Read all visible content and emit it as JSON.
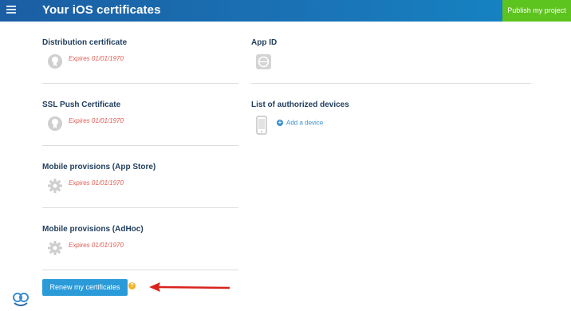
{
  "header": {
    "title": "Your iOS certificates",
    "publish_label": "Publish my project"
  },
  "left_sections": [
    {
      "title": "Distribution certificate",
      "status": "Expires 01/01/1970",
      "icon": "certificate-seal-icon"
    },
    {
      "title": "SSL Push Certificate",
      "status": "Expires 01/01/1970",
      "icon": "certificate-seal-icon"
    },
    {
      "title": "Mobile provisions (App Store)",
      "status": "Expires 01/01/1970",
      "icon": "gear-icon"
    },
    {
      "title": "Mobile provisions (AdHoc)",
      "status": "Expires 01/01/1970",
      "icon": "gear-icon"
    }
  ],
  "right_sections": {
    "app_id": {
      "title": "App ID",
      "icon": "app-id-icon"
    },
    "devices": {
      "title": "List of authorized devices",
      "add_label": "Add a device",
      "icon": "phone-icon"
    }
  },
  "footer": {
    "renew_label": "Renew my certificates",
    "help_glyph": "?"
  },
  "colors": {
    "header_start": "#1b5ea3",
    "header_end": "#1487c5",
    "publish_green": "#5dc31e",
    "expired_red": "#e3594f",
    "button_blue": "#2a9ad9",
    "arrow_red": "#d9231d"
  }
}
